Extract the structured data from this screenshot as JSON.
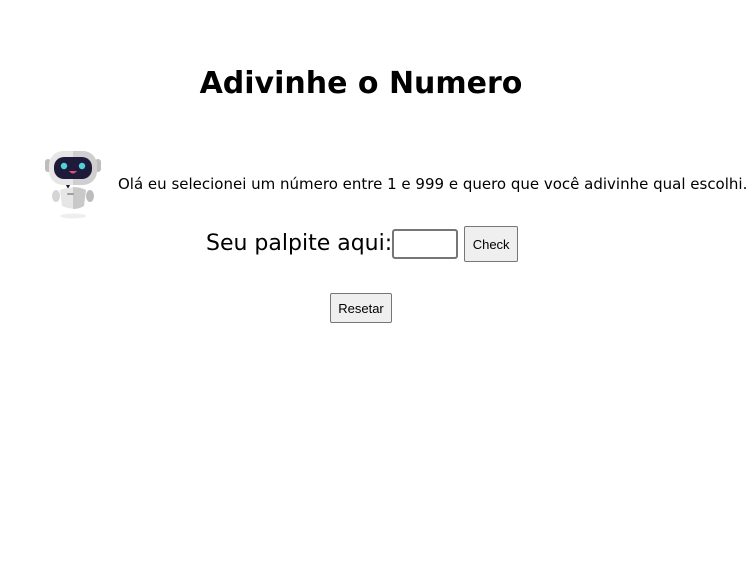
{
  "header": {
    "title": "Adivinhe o Numero"
  },
  "intro": {
    "robot_icon": "robot-icon",
    "message": "Olá eu selecionei um número entre 1 e 999 e quero que você adivinhe qual escolhi."
  },
  "guess": {
    "label": "Seu palpite aqui:",
    "input_value": "",
    "check_label": "Check"
  },
  "controls": {
    "reset_label": "Resetar"
  },
  "colors": {
    "background": "#ffffff",
    "button_bg": "#efefef",
    "robot_visor": "#1e1b3a",
    "robot_eyes": "#4fd3d8",
    "robot_body": "#dcdcdc"
  }
}
